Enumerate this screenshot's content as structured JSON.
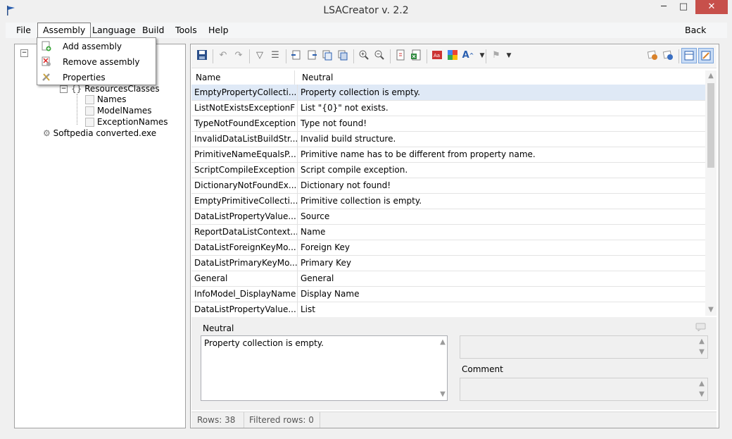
{
  "window": {
    "title": "LSACreator v. 2.2",
    "minimize": "─",
    "maximize": "□",
    "close": "✕"
  },
  "menubar": {
    "items": [
      "File",
      "Assembly",
      "Language",
      "Build",
      "Tools",
      "Help"
    ],
    "active": "Assembly",
    "back": "Back"
  },
  "assembly_menu": {
    "items": [
      {
        "label": "Add assembly",
        "icon": "add-assembly-icon"
      },
      {
        "label": "Remove assembly",
        "icon": "remove-assembly-icon"
      },
      {
        "label": "Properties",
        "icon": "properties-icon"
      }
    ]
  },
  "tree": {
    "partial_node": "ResourcesClasses",
    "children": [
      "Names",
      "ModelNames",
      "ExceptionNames"
    ],
    "root2": "Softpedia converted.exe"
  },
  "grid": {
    "columns": [
      "Name",
      "Neutral"
    ],
    "rows": [
      {
        "name": "EmptyPropertyCollecti...",
        "value": "Property collection is empty."
      },
      {
        "name": "ListNotExistsExceptionF",
        "value": "List \"{0}\" not exists."
      },
      {
        "name": "TypeNotFoundException",
        "value": "Type not found!"
      },
      {
        "name": "InvalidDataListBuildStr...",
        "value": "Invalid build structure."
      },
      {
        "name": "PrimitiveNameEqualsP...",
        "value": "Primitive name has to be different from property name."
      },
      {
        "name": "ScriptCompileException",
        "value": "Script compile exception."
      },
      {
        "name": "DictionaryNotFoundEx...",
        "value": "Dictionary not found!"
      },
      {
        "name": "EmptyPrimitiveCollecti...",
        "value": "Primitive collection is empty."
      },
      {
        "name": "DataListPropertyValue...",
        "value": "Source"
      },
      {
        "name": "ReportDataListContext...",
        "value": "Name"
      },
      {
        "name": "DataListForeignKeyMo...",
        "value": "Foreign Key"
      },
      {
        "name": "DataListPrimaryKeyMo...",
        "value": "Primary Key"
      },
      {
        "name": "General",
        "value": "General"
      },
      {
        "name": "InfoModel_DisplayName",
        "value": "Display Name"
      },
      {
        "name": "DataListPropertyValue...",
        "value": "List"
      }
    ]
  },
  "editor": {
    "neutral_label": "Neutral",
    "neutral_text": "Property collection is empty.",
    "comment_label": "Comment"
  },
  "status": {
    "rows_label": "Rows:",
    "rows": "38",
    "filtered_label": "Filtered rows:",
    "filtered": "0"
  },
  "colors": {
    "selected_row": "#dfe9f6",
    "close_button": "#c7504b"
  }
}
